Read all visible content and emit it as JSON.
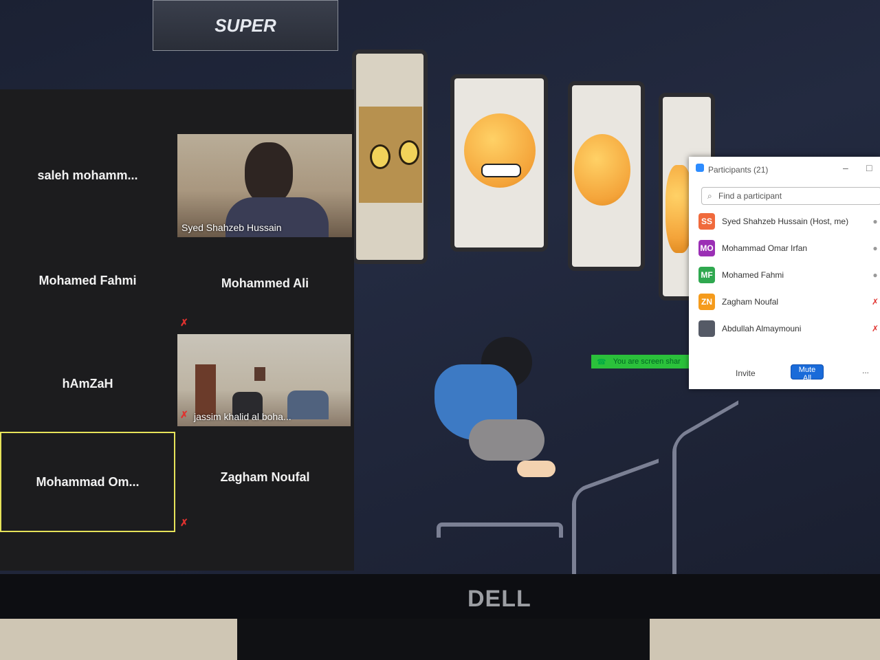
{
  "logo": {
    "text": "SUPER"
  },
  "gallery": {
    "tiles": [
      {
        "name": "saleh  mohamm..."
      },
      {
        "name": "Mohamed Fahmi"
      },
      {
        "name": "Mohammed Ali"
      },
      {
        "name": "hAmZaH"
      },
      {
        "name": "Mohammad  Om..."
      },
      {
        "name": "Zagham Noufal"
      }
    ],
    "videos": [
      {
        "caption": "Syed Shahzeb Hussain"
      },
      {
        "caption": "jassim khalid al boha..."
      }
    ]
  },
  "participants": {
    "title": "Participants (21)",
    "search_placeholder": "Find a participant",
    "rows": [
      {
        "initials": "SS",
        "name": "Syed Shahzeb Hussain (Host, me)",
        "color": "#f06a3c"
      },
      {
        "initials": "MO",
        "name": "Mohammad Omar Irfan",
        "color": "#9b2fb5"
      },
      {
        "initials": "MF",
        "name": "Mohamed Fahmi",
        "color": "#2fa84f"
      },
      {
        "initials": "ZN",
        "name": "Zagham Noufal",
        "color": "#f59b1c"
      },
      {
        "initials": "",
        "name": "Abdullah Almaymouni",
        "color": "#555a66"
      }
    ],
    "invite_label": "Invite",
    "mute_all_label": "Mute All",
    "more_label": "..."
  },
  "share_banner": {
    "text": "You are screen shar"
  },
  "brand": {
    "text": "DELL"
  },
  "colors": {
    "accent": "#1a6bd9",
    "mic_off": "#e0322f",
    "active_border": "#e6e35a"
  },
  "icons": [
    "mic-off-icon",
    "search-icon",
    "phone-icon",
    "minimize-icon",
    "maximize-icon",
    "participants-icon"
  ]
}
